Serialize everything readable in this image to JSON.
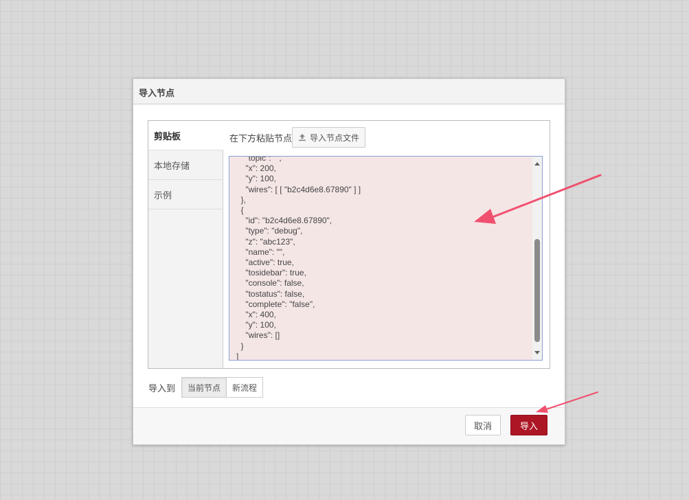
{
  "dialog": {
    "title": "导入节点"
  },
  "tabs": [
    {
      "label": "剪贴板",
      "active": true
    },
    {
      "label": "本地存储",
      "active": false
    },
    {
      "label": "示例",
      "active": false
    }
  ],
  "clipboard": {
    "paste_label": "在下方粘贴节点",
    "upload_button_label": "导入节点文件",
    "upload_icon": "upload-icon",
    "code_lines": [
      "    \"topic\": \"\",",
      "    \"x\": 200,",
      "    \"y\": 100,",
      "    \"wires\": [ [ \"b2c4d6e8.67890\" ] ]",
      "  },",
      "  {",
      "    \"id\": \"b2c4d6e8.67890\",",
      "    \"type\": \"debug\",",
      "    \"z\": \"abc123\",",
      "    \"name\": \"\",",
      "    \"active\": true,",
      "    \"tosidebar\": true,",
      "    \"console\": false,",
      "    \"tostatus\": false,",
      "    \"complete\": \"false\",",
      "    \"x\": 400,",
      "    \"y\": 100,",
      "    \"wires\": []",
      "  }",
      "]"
    ]
  },
  "import_to": {
    "label": "导入到",
    "options": [
      {
        "label": "当前节点",
        "selected": true
      },
      {
        "label": "新流程",
        "selected": false
      }
    ]
  },
  "footer": {
    "cancel_label": "取消",
    "import_label": "导入"
  },
  "colors": {
    "accent": "#ad1625",
    "editor_bg": "#f5e6e6",
    "annotation_arrow": "#f0506e"
  }
}
